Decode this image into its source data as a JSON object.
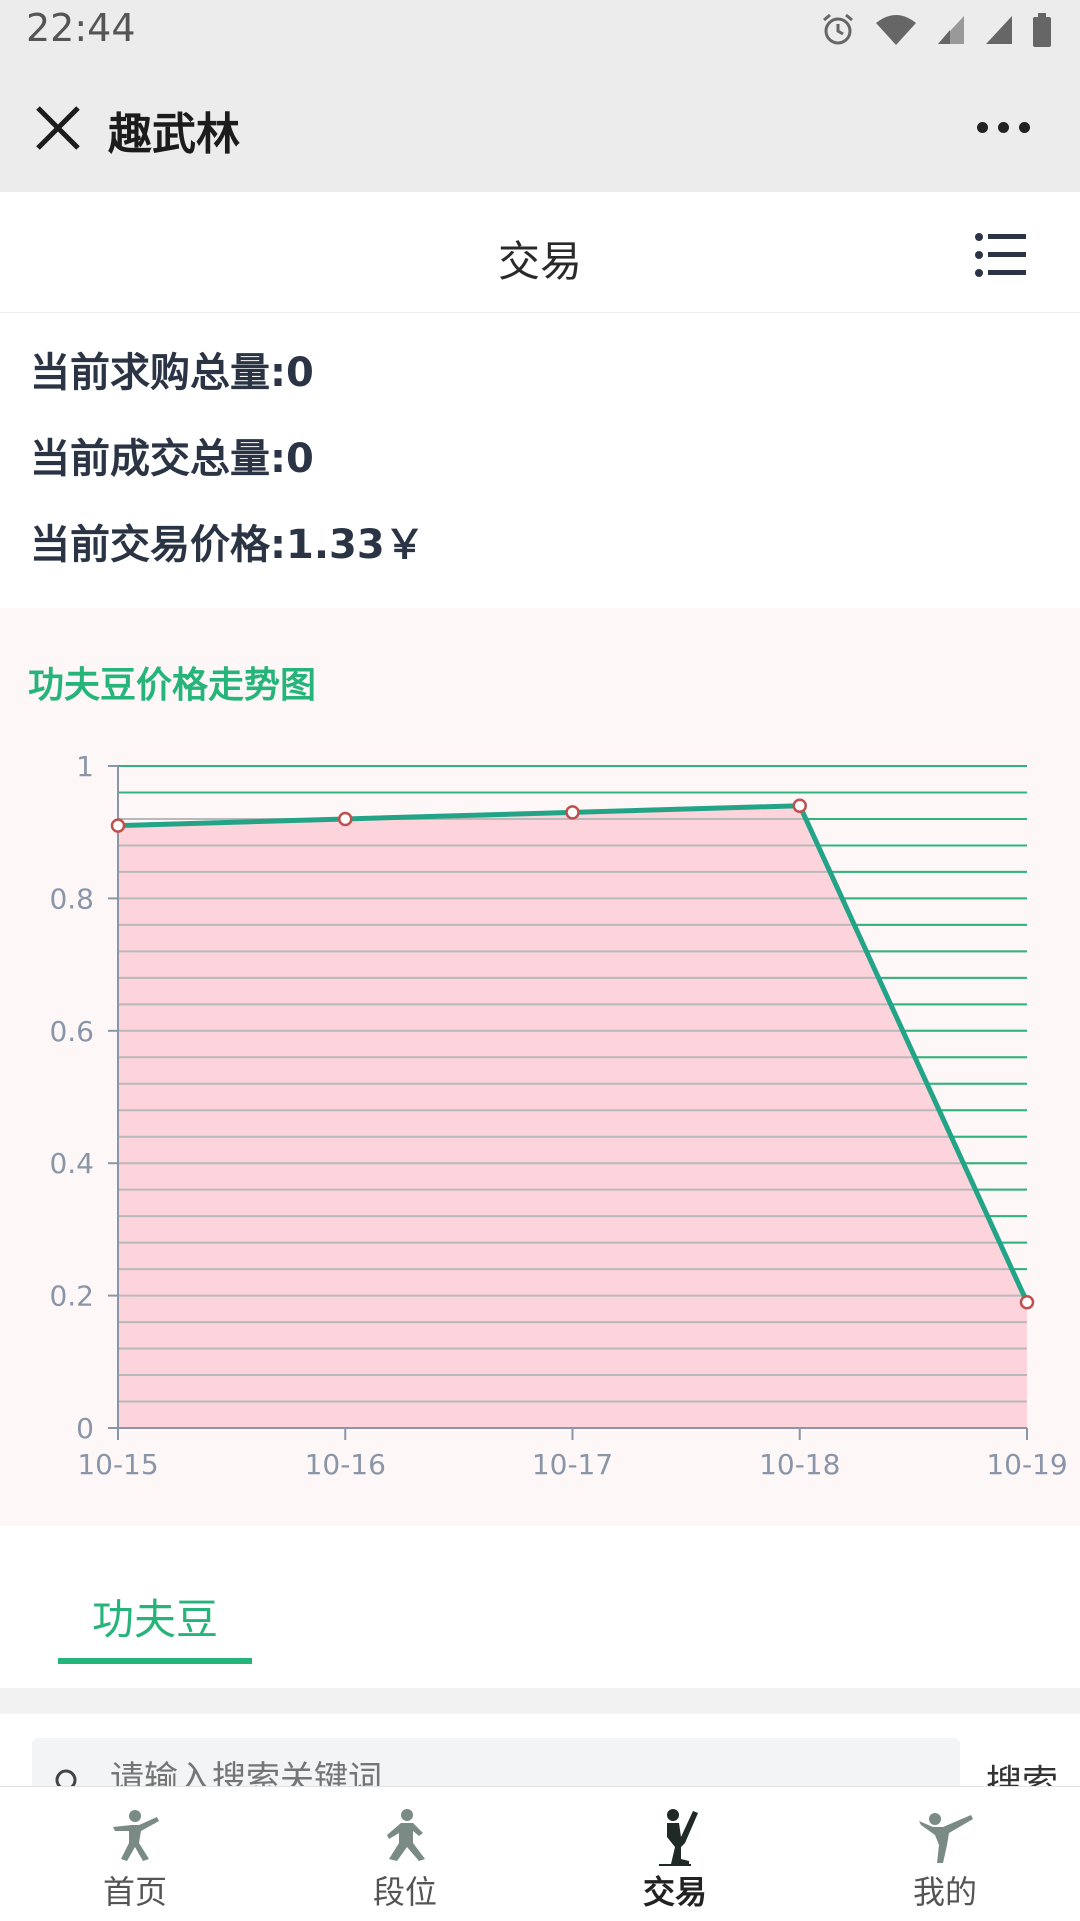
{
  "status_bar": {
    "time": "22:44"
  },
  "app_bar": {
    "title": "趣武林"
  },
  "page_header": {
    "title": "交易"
  },
  "stats": {
    "demand_total": "当前求购总量:0",
    "deal_total": "当前成交总量:0",
    "current_price": "当前交易价格:1.33￥"
  },
  "chart_title": "功夫豆价格走势图",
  "chart_data": {
    "type": "area",
    "title": "功夫豆价格走势图",
    "x": [
      "10-15",
      "10-16",
      "10-17",
      "10-18",
      "10-19"
    ],
    "series": [
      {
        "values": [
          0.91,
          0.92,
          0.93,
          0.94,
          0.19
        ]
      }
    ],
    "yticks": [
      "0",
      "0.2",
      "0.4",
      "0.6",
      "0.8",
      "1"
    ],
    "ylim": [
      0,
      1
    ],
    "grid": true,
    "colors": {
      "line": "#23a487",
      "fill": "#fdd4db",
      "marker": "#c0504d"
    }
  },
  "tabs": [
    {
      "label": "功夫豆",
      "active": true
    }
  ],
  "search": {
    "placeholder": "请输入搜索关键词",
    "button_label": "搜索"
  },
  "bottom_nav": [
    {
      "label": "首页",
      "icon": "martial-arts-pose-icon"
    },
    {
      "label": "段位",
      "icon": "martial-arts-stance-icon"
    },
    {
      "label": "交易",
      "icon": "martial-arts-kick-icon",
      "active": true
    },
    {
      "label": "我的",
      "icon": "martial-arts-high-kick-icon"
    }
  ]
}
